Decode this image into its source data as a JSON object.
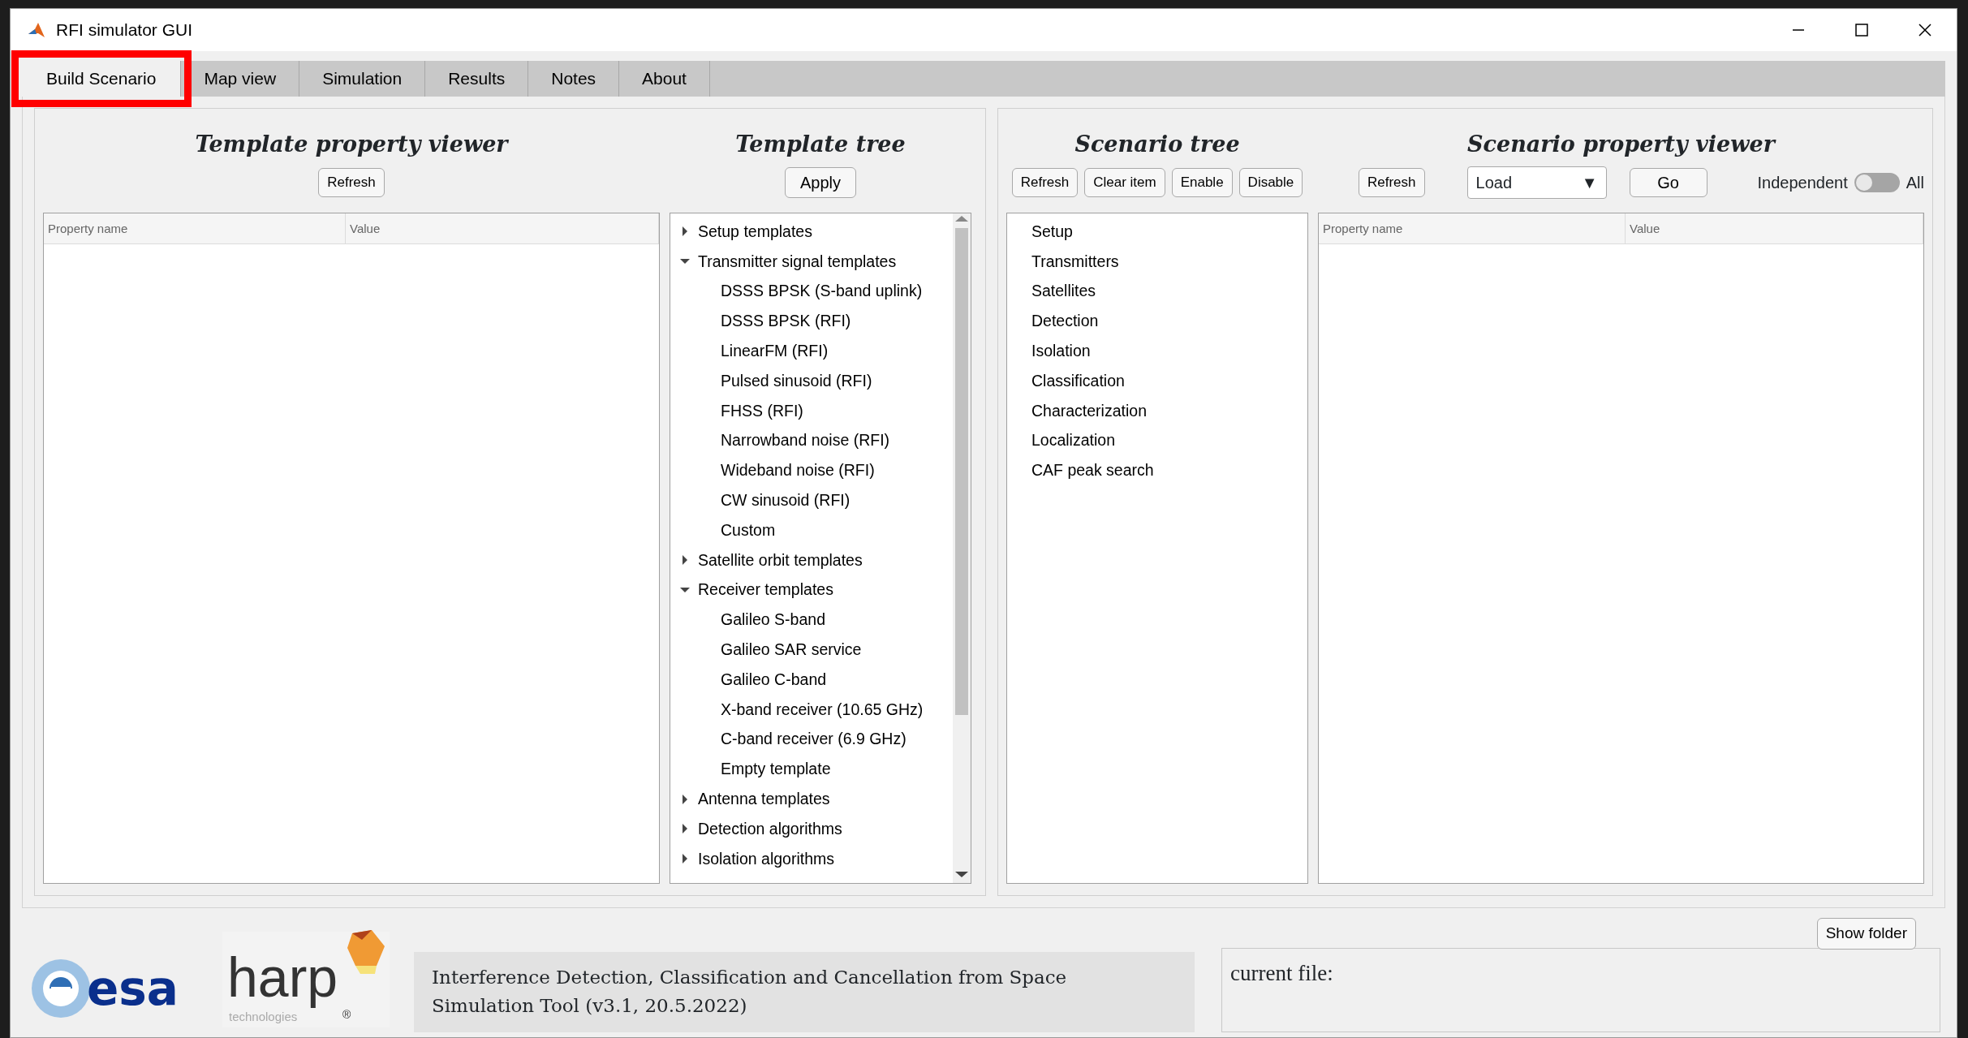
{
  "window": {
    "title": "RFI simulator GUI"
  },
  "tabs": [
    {
      "label": "Build Scenario",
      "selected": true,
      "highlighted": true
    },
    {
      "label": "Map view",
      "selected": false,
      "highlighted": false
    },
    {
      "label": "Simulation",
      "selected": false,
      "highlighted": false
    },
    {
      "label": "Results",
      "selected": false,
      "highlighted": false
    },
    {
      "label": "Notes",
      "selected": false,
      "highlighted": false
    },
    {
      "label": "About",
      "selected": false,
      "highlighted": false
    }
  ],
  "template_property_viewer": {
    "title": "Template property viewer",
    "button": "Refresh",
    "columns": [
      "Property name",
      "Value"
    ]
  },
  "template_tree": {
    "title": "Template tree",
    "button": "Apply",
    "items": [
      {
        "label": "Setup templates",
        "expanded": false
      },
      {
        "label": "Transmitter signal templates",
        "expanded": true,
        "children": [
          {
            "label": "DSSS BPSK (S-band uplink)"
          },
          {
            "label": "DSSS BPSK (RFI)"
          },
          {
            "label": "LinearFM (RFI)"
          },
          {
            "label": "Pulsed sinusoid (RFI)"
          },
          {
            "label": "FHSS (RFI)"
          },
          {
            "label": "Narrowband noise (RFI)"
          },
          {
            "label": "Wideband noise (RFI)"
          },
          {
            "label": "CW sinusoid (RFI)"
          },
          {
            "label": "Custom"
          }
        ]
      },
      {
        "label": "Satellite orbit templates",
        "expanded": false
      },
      {
        "label": "Receiver templates",
        "expanded": true,
        "children": [
          {
            "label": "Galileo S-band"
          },
          {
            "label": "Galileo SAR service"
          },
          {
            "label": "Galileo C-band"
          },
          {
            "label": "X-band receiver (10.65 GHz)"
          },
          {
            "label": "C-band receiver (6.9 GHz)"
          },
          {
            "label": "Empty template"
          }
        ]
      },
      {
        "label": "Antenna templates",
        "expanded": false
      },
      {
        "label": "Detection algorithms",
        "expanded": false
      },
      {
        "label": "Isolation algorithms",
        "expanded": false
      }
    ]
  },
  "scenario_tree": {
    "title": "Scenario tree",
    "buttons": [
      "Refresh",
      "Clear item",
      "Enable",
      "Disable"
    ],
    "items": [
      "Setup",
      "Transmitters",
      "Satellites",
      "Detection",
      "Isolation",
      "Classification",
      "Characterization",
      "Localization",
      "CAF peak search"
    ]
  },
  "scenario_property_viewer": {
    "title": "Scenario property viewer",
    "button": "Refresh",
    "dropdown": {
      "value": "Load",
      "arrow": "▼"
    },
    "go_button": "Go",
    "toggle": {
      "left_label": "Independent",
      "right_label": "All",
      "on": false
    },
    "columns": [
      "Property name",
      "Value"
    ]
  },
  "footer": {
    "show_folder_button": "Show folder",
    "esa_logo": "esa",
    "harp_logo": {
      "name": "harp",
      "sub": "technologies",
      "mark": "®"
    },
    "description": "Interference Detection, Classification and Cancellation from Space\nSimulation Tool (v3.1, 20.5.2022)",
    "current_file": "current file:"
  }
}
